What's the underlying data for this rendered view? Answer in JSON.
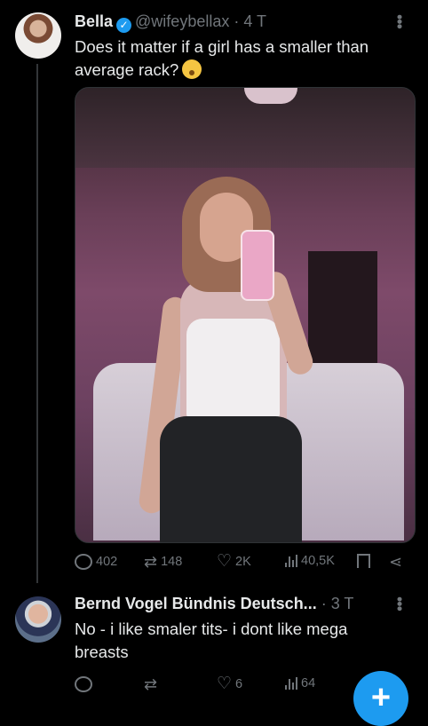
{
  "tweet": {
    "name": "Bella",
    "handle": "@wifeybellax",
    "time": "· 4 T",
    "text_line1": "Does it matter if a girl has a smaller than",
    "text_line2": "average rack?",
    "emoji_icon": "flushed-face-icon",
    "media_icon": "selfie-photo",
    "counts": {
      "replies": "402",
      "reposts": "148",
      "likes": "2K",
      "views": "40,5K"
    }
  },
  "reply": {
    "name": "Bernd Vogel Bündnis Deutsch...",
    "time": "· 3 T",
    "text_line1": "No - i like smaler tits- i dont like mega",
    "text_line2": "breasts",
    "counts": {
      "replies": "",
      "reposts": "",
      "likes": "6",
      "views": "64"
    }
  },
  "fab": {
    "label": "+"
  },
  "colors": {
    "accent": "#1d9bf0",
    "muted": "#71767b",
    "background": "#000000",
    "text": "#e7e9ea"
  }
}
